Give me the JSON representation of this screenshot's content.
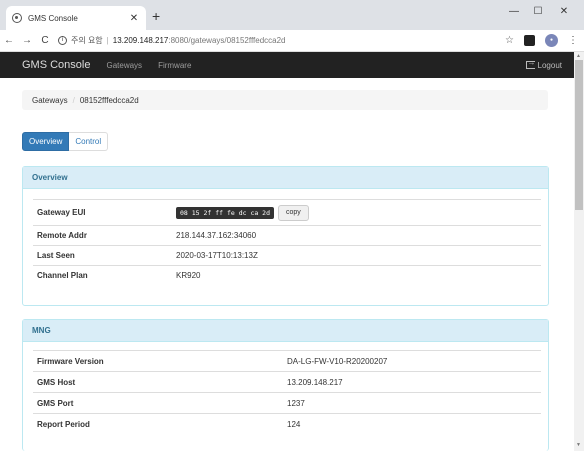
{
  "browser": {
    "tab_title": "GMS Console",
    "tab_close": "✕",
    "new_tab": "+",
    "win_minimize": "—",
    "win_maximize": "☐",
    "win_close": "✕",
    "back": "←",
    "forward": "→",
    "reload": "C",
    "security_label": "주의 요함",
    "url_host": "13.209.148.217",
    "url_path": ":8080/gateways/08152fffedcca2d",
    "star": "☆",
    "kebab": "⋮"
  },
  "navbar": {
    "brand": "GMS Console",
    "links": [
      "Gateways",
      "Firmware"
    ],
    "logout": "Logout"
  },
  "breadcrumb": {
    "root": "Gateways",
    "separator": "/",
    "current": "08152fffedcca2d"
  },
  "tabs": {
    "overview": "Overview",
    "control": "Control"
  },
  "overview_panel": {
    "title": "Overview",
    "rows": [
      {
        "key": "Gateway EUI",
        "value": "08 15 2f ff fe dc ca 2d"
      },
      {
        "key": "Remote Addr",
        "value": "218.144.37.162:34060"
      },
      {
        "key": "Last Seen",
        "value": "2020-03-17T10:13:13Z"
      },
      {
        "key": "Channel Plan",
        "value": "KR920"
      }
    ],
    "copy_label": "copy"
  },
  "mng_panel": {
    "title": "MNG",
    "rows": [
      {
        "key": "Firmware Version",
        "value": "DA-LG-FW-V10-R20200207"
      },
      {
        "key": "GMS Host",
        "value": "13.209.148.217"
      },
      {
        "key": "GMS Port",
        "value": "1237"
      },
      {
        "key": "Report Period",
        "value": "124"
      }
    ]
  }
}
